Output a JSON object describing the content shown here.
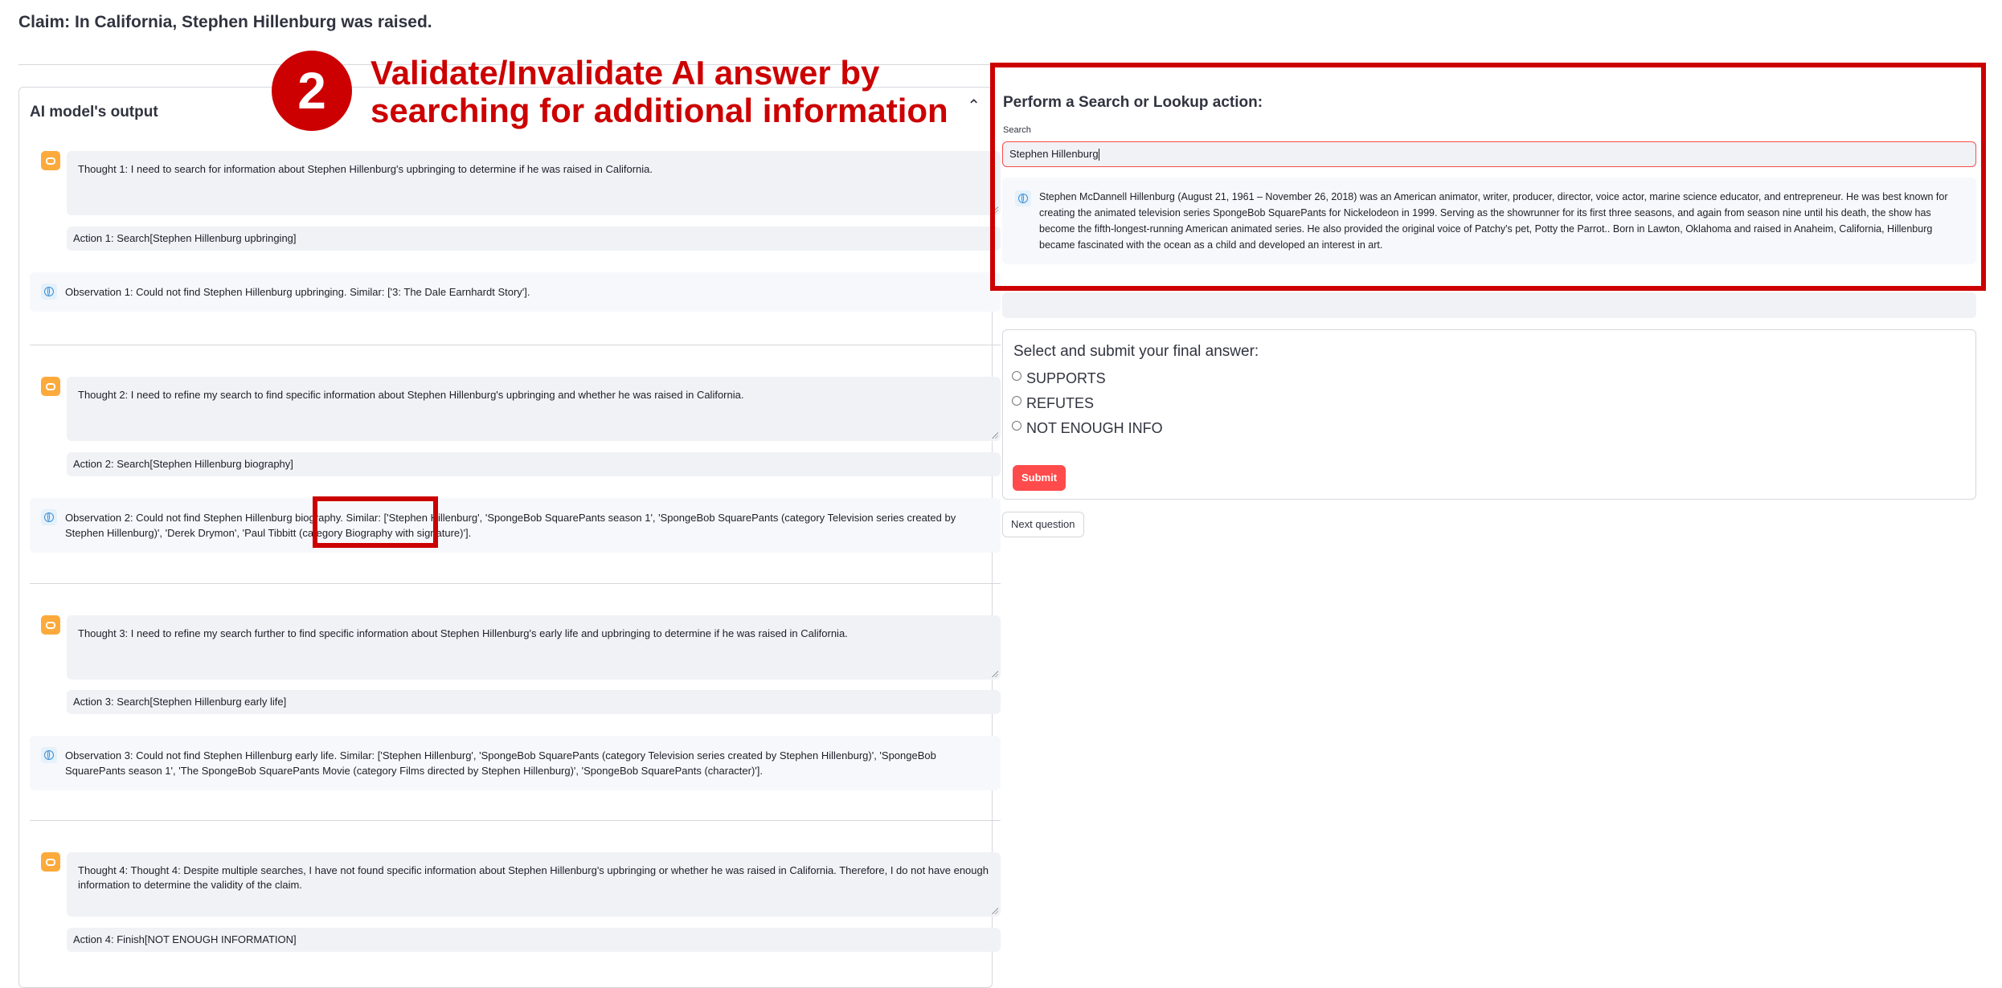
{
  "claim": "Claim: In California, Stephen Hillenburg was raised.",
  "left_panel": {
    "title": "AI model's output",
    "caret": "⌃",
    "steps": [
      {
        "thought": "Thought 1: I need to search for information about Stephen Hillenburg's upbringing to determine if he was raised in California.",
        "action": "Action 1: Search[Stephen Hillenburg upbringing]",
        "observation": "Observation 1: Could not find Stephen Hillenburg upbringing. Similar: ['3: The Dale Earnhardt Story']."
      },
      {
        "thought": "Thought 2: I need to refine my search to find specific information about Stephen Hillenburg's upbringing and whether he was raised in California.",
        "action": "Action 2: Search[Stephen Hillenburg biography]",
        "observation": "Observation 2: Could not find Stephen Hillenburg biography. Similar: ['Stephen Hillenburg', 'SpongeBob SquarePants season 1', 'SpongeBob SquarePants (category Television series created by Stephen Hillenburg)', 'Derek Drymon', 'Paul Tibbitt (category Biography with signature)']."
      },
      {
        "thought": "Thought 3: I need to refine my search further to find specific information about Stephen Hillenburg's early life and upbringing to determine if he was raised in California.",
        "action": "Action 3: Search[Stephen Hillenburg early life]",
        "observation": "Observation 3: Could not find Stephen Hillenburg early life. Similar: ['Stephen Hillenburg', 'SpongeBob SquarePants (category Television series created by Stephen Hillenburg)', 'SpongeBob SquarePants season 1', 'The SpongeBob SquarePants Movie (category Films directed by Stephen Hillenburg)', 'SpongeBob SquarePants (character)']."
      },
      {
        "thought": "Thought 4: Thought 4: Despite multiple searches, I have not found specific information about Stephen Hillenburg's upbringing or whether he was raised in California. Therefore, I do not have enough information to determine the validity of the claim.",
        "action": "Action 4: Finish[NOT ENOUGH INFORMATION]"
      }
    ]
  },
  "right_panel": {
    "title": "Perform a Search or Lookup action:",
    "search_label": "Search",
    "search_value": "Stephen Hillenburg",
    "search_result": "Stephen McDannell Hillenburg (August 21, 1961 – November 26, 2018) was an American animator, writer, producer, director, voice actor, marine science educator, and entrepreneur. He was best known for creating the animated television series SpongeBob SquarePants for Nickelodeon in 1999. Serving as the showrunner for its first three seasons, and again from season nine until his death, the show has become the fifth-longest-running American animated series. He also provided the original voice of Patchy's pet, Potty the Parrot.. Born in Lawton, Oklahoma and raised in Anaheim, California, Hillenburg became fascinated with the ocean as a child and developed an interest in art.",
    "final_answer_title": "Select and submit your final answer:",
    "options": [
      "SUPPORTS",
      "REFUTES",
      "NOT ENOUGH INFO"
    ],
    "submit_label": "Submit",
    "next_label": "Next question"
  },
  "annotation": {
    "step_number": "2",
    "line1": "Validate/Invalidate AI answer by",
    "line2": "searching for additional information"
  },
  "colors": {
    "accent": "#ff4b4b",
    "annotation_red": "#cc0000",
    "bot_icon": "#fcaa3c",
    "field_bg": "#f0f2f6"
  }
}
